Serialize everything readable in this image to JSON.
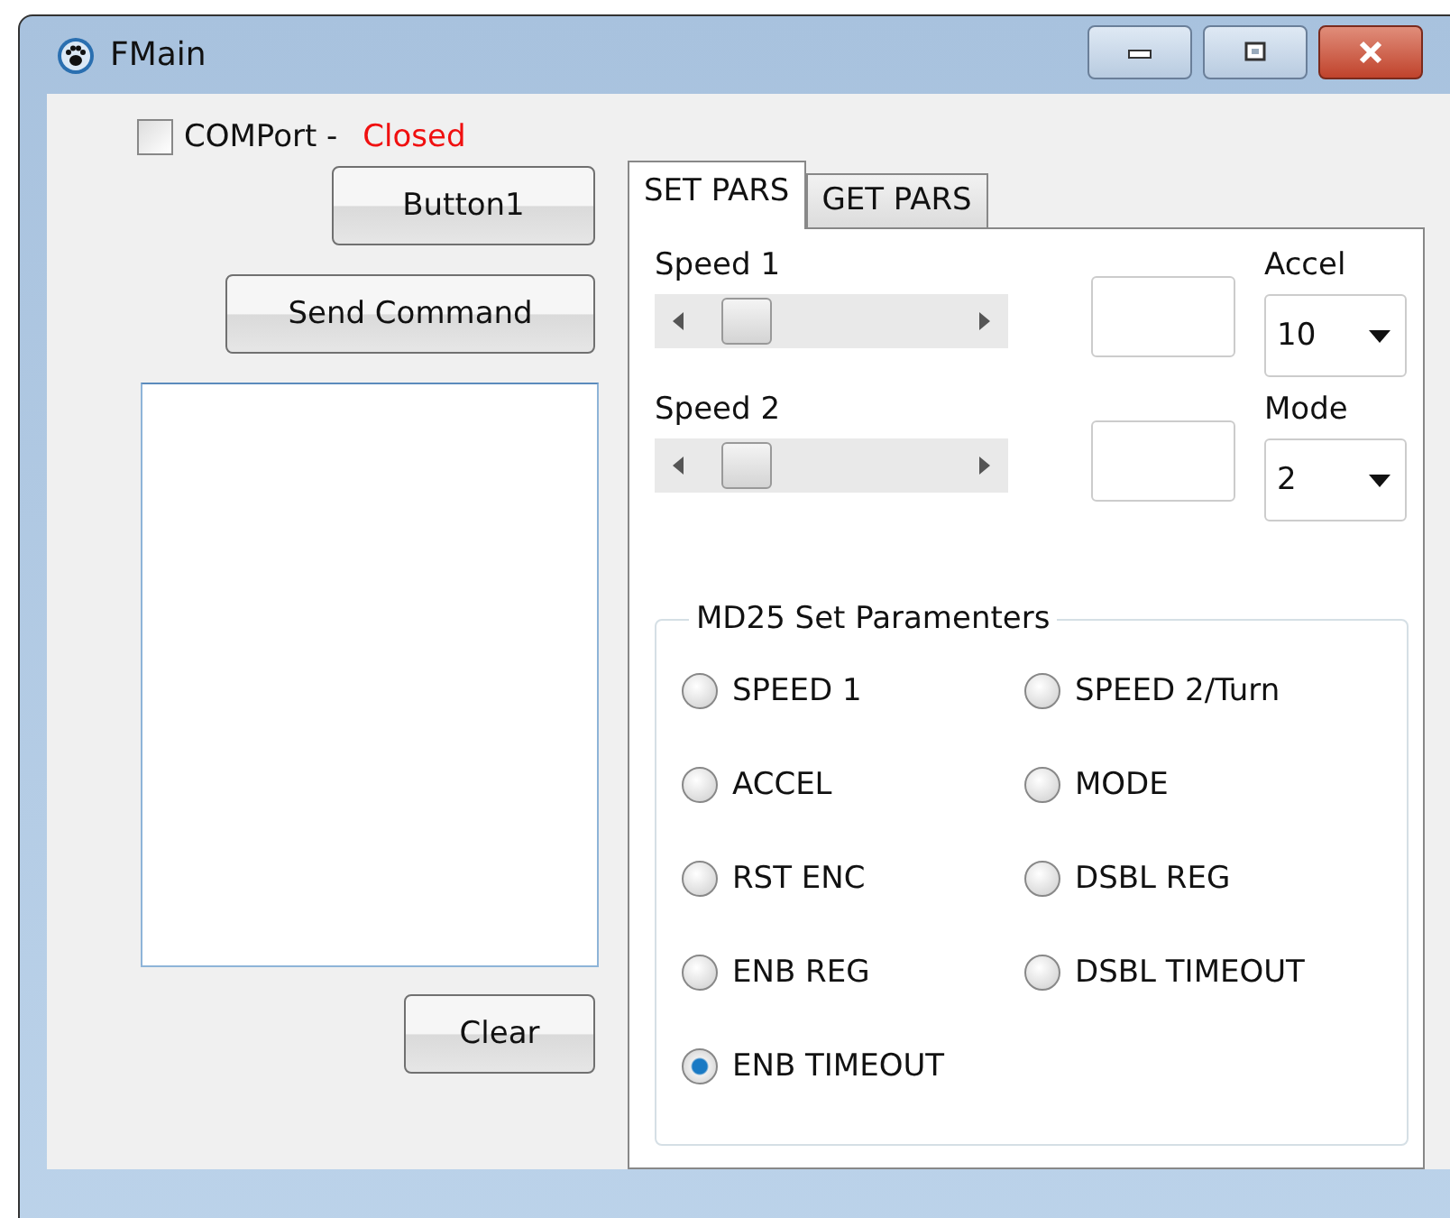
{
  "window": {
    "title": "FMain"
  },
  "comport": {
    "label": "COMPort -",
    "checked": false,
    "status": "Closed"
  },
  "buttons": {
    "button1": "Button1",
    "send": "Send Command",
    "clear": "Clear"
  },
  "tabs": [
    {
      "label": "SET PARS",
      "selected": true
    },
    {
      "label": "GET PARS",
      "selected": false
    }
  ],
  "speeds": [
    {
      "label": "Speed 1",
      "combo_label": "Accel",
      "combo_value": "10"
    },
    {
      "label": "Speed 2",
      "combo_label": "Mode",
      "combo_value": "2"
    }
  ],
  "group": {
    "title": "MD25 Set Paramenters",
    "options": [
      {
        "label": "SPEED 1",
        "selected": false
      },
      {
        "label": "SPEED 2/Turn",
        "selected": false
      },
      {
        "label": "ACCEL",
        "selected": false
      },
      {
        "label": "MODE",
        "selected": false
      },
      {
        "label": "RST ENC",
        "selected": false
      },
      {
        "label": "DSBL REG",
        "selected": false
      },
      {
        "label": "ENB REG",
        "selected": false
      },
      {
        "label": "DSBL TIMEOUT",
        "selected": false
      },
      {
        "label": "ENB TIMEOUT",
        "selected": true
      }
    ]
  }
}
